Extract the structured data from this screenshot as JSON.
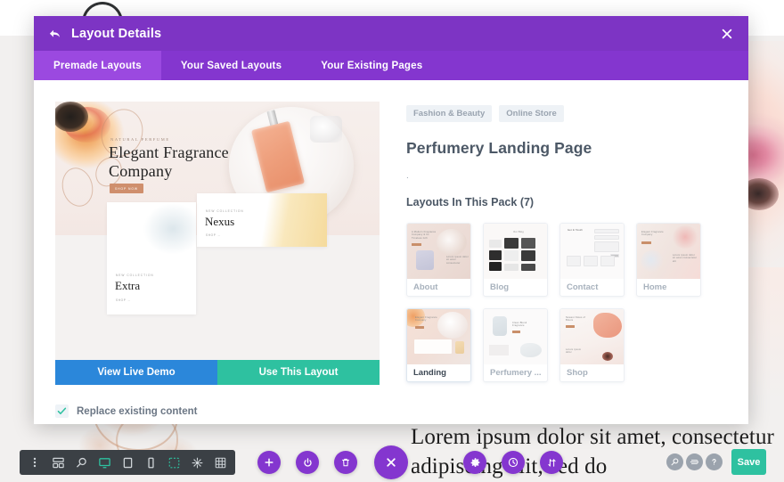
{
  "background": {
    "lorem_text": "Lorem ipsum dolor sit amet, consectetur adipiscing elit, sed do"
  },
  "modal": {
    "title": "Layout Details",
    "back_icon": "back-arrow-icon",
    "close_icon": "close-icon",
    "tabs": [
      {
        "label": "Premade Layouts",
        "active": true
      },
      {
        "label": "Your Saved Layouts",
        "active": false
      },
      {
        "label": "Your Existing Pages",
        "active": false
      }
    ]
  },
  "preview": {
    "eyebrow": "NATURAL PERFUME",
    "title": "Elegant Fragrance Company",
    "cta_label": "SHOP NOW",
    "card_a": {
      "eyebrow": "NEW COLLECTION",
      "name": "Extra",
      "more": "SHOP →"
    },
    "card_b": {
      "eyebrow": "NEW COLLECTION",
      "name": "Nexus",
      "more": "SHOP →"
    }
  },
  "actions": {
    "view_demo_label": "View Live Demo",
    "use_layout_label": "Use This Layout",
    "replace_label": "Replace existing content",
    "replace_checked": true,
    "check_icon": "check-icon"
  },
  "details": {
    "categories": [
      "Fashion & Beauty",
      "Online Store"
    ],
    "pack_title": "Perfumery Landing Page",
    "description": ".",
    "pack_count_label": "Layouts In This Pack (7)",
    "layouts": [
      {
        "name": "About",
        "art": "th-about",
        "active": false
      },
      {
        "name": "Blog",
        "art": "th-blog",
        "active": false
      },
      {
        "name": "Contact",
        "art": "th-contact",
        "active": false
      },
      {
        "name": "Home",
        "art": "th-home",
        "active": false
      },
      {
        "name": "Landing",
        "art": "th-landing",
        "active": true
      },
      {
        "name": "Perfumery ...",
        "art": "th-perf",
        "active": false
      },
      {
        "name": "Shop",
        "art": "th-shop",
        "active": false
      }
    ]
  },
  "toolbar": {
    "left_group": [
      "vertical-dots-icon",
      "layout-blocks-icon",
      "search-icon",
      "desktop-icon",
      "tablet-icon",
      "phone-icon"
    ],
    "mid_group": [
      "select-region-icon",
      "wireframe-icon",
      "grid-icon"
    ],
    "circle_buttons": [
      "add-icon",
      "power-icon",
      "trash-icon",
      "close-icon",
      "gear-icon",
      "history-clock-icon",
      "sort-icon"
    ],
    "grey_buttons": [
      "search-icon",
      "divi-icon",
      "help-icon"
    ],
    "save_label": "Save"
  },
  "colors": {
    "modal_header": "#7d34c4",
    "tab_bar": "#8436cf",
    "tab_active": "#9b49e0",
    "demo_blue": "#2b87da",
    "use_teal": "#2ec1a0",
    "toolbar_dark": "#3b4045",
    "accent_purple": "#8436cf"
  }
}
